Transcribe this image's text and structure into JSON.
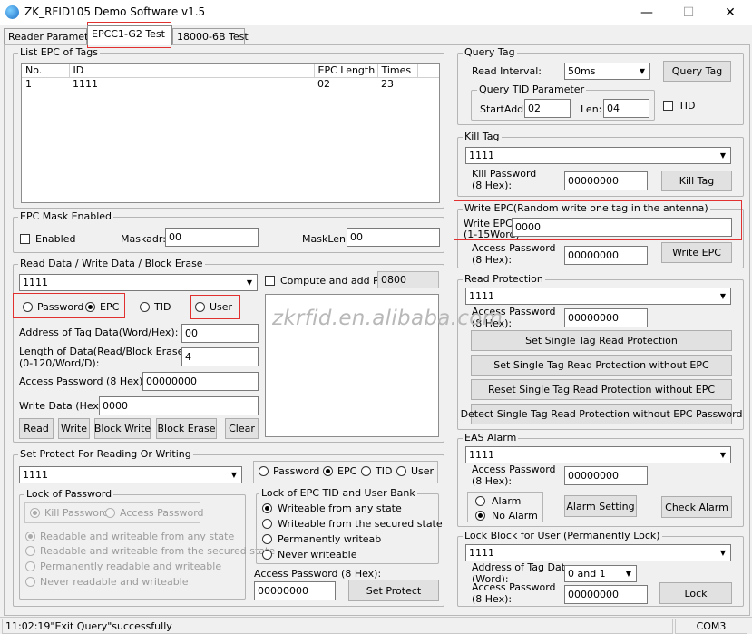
{
  "window": {
    "title": "ZK_RFID105 Demo Software v1.5",
    "minimize": "—",
    "maximize": "☐",
    "close": "✕"
  },
  "tabs": [
    "Reader Parameter",
    "EPCC1-G2 Test",
    "18000-6B Test"
  ],
  "list_epc": {
    "legend": "List EPC of Tags",
    "columns": [
      "No.",
      "ID",
      "EPC Length",
      "Times"
    ],
    "rows": [
      [
        "1",
        "1111",
        "02",
        "23"
      ]
    ]
  },
  "epc_mask": {
    "legend": "EPC Mask Enabled",
    "enabled_label": "Enabled",
    "maskadr_label": "Maskadr:",
    "maskadr_value": "00",
    "masklen_label": "MaskLen:",
    "masklen_value": "00"
  },
  "rw": {
    "legend": "Read Data / Write Data / Block Erase",
    "tag_select": "1111",
    "compute_pc_label": "Compute and add PC:",
    "pc_value": "0800",
    "radio_password": "Password",
    "radio_epc": "EPC",
    "radio_tid": "TID",
    "radio_user": "User",
    "addr_label": "Address of Tag Data(Word/Hex):",
    "addr_value": "00",
    "length_label_1": "Length of Data(Read/Block Erase)",
    "length_label_2": "(0-120/Word/D):",
    "length_value": "4",
    "access_pwd_label": "Access Password (8 Hex):",
    "access_pwd_value": "00000000",
    "write_data_label": "Write Data (Hex):",
    "write_data_value": "0000",
    "btn_read": "Read",
    "btn_write": "Write",
    "btn_block_write": "Block Write",
    "btn_block_erase": "Block Erase",
    "btn_clear": "Clear"
  },
  "protect": {
    "legend": "Set Protect For Reading Or Writing",
    "tag_select": "1111",
    "radio_password": "Password",
    "radio_epc": "EPC",
    "radio_tid": "TID",
    "radio_user": "User",
    "lock_pwd_legend": "Lock of Password",
    "kill_password": "Kill Password",
    "access_password": "Access Password",
    "opt1": "Readable and  writeable from any state",
    "opt2": "Readable and writeable from the secured state",
    "opt3": "Permanently readable and writeable",
    "opt4": "Never readable and writeable",
    "lock_epc_legend": "Lock of EPC TID and User Bank",
    "e1": "Writeable from any state",
    "e2": "Writeable from the secured state",
    "e3": "Permanently writeab",
    "e4": "Never writeable",
    "access_label": "Access Password (8 Hex):",
    "access_value": "00000000",
    "btn_set_protect": "Set Protect"
  },
  "query": {
    "legend": "Query Tag",
    "interval_label": "Read Interval:",
    "interval_value": "50ms",
    "btn_query": "Query Tag",
    "tid_legend": "Query TID Parameter",
    "start_label": "StartAddr:",
    "start_value": "02",
    "len_label": "Len:",
    "len_value": "04",
    "tid_check": "TID"
  },
  "kill": {
    "legend": "Kill Tag",
    "tag_select": "1111",
    "pwd_label_1": "Kill Password",
    "pwd_label_2": "(8 Hex):",
    "pwd_value": "00000000",
    "btn_kill": "Kill Tag"
  },
  "write_epc": {
    "legend": "Write EPC(Random write one tag in the antenna)",
    "epc_label_1": "Write EPC:",
    "epc_label_2": "(1-15Word)",
    "epc_value": "0000",
    "pwd_label_1": "Access Password",
    "pwd_label_2": "(8 Hex):",
    "pwd_value": "00000000",
    "btn_write": "Write EPC"
  },
  "read_protect": {
    "legend": "Read Protection",
    "tag_select": "1111",
    "pwd_label_1": "Access Password",
    "pwd_label_2": "(8 Hex):",
    "pwd_value": "00000000",
    "btn1": "Set Single Tag Read Protection",
    "btn2": "Set Single Tag Read Protection without EPC",
    "btn3": "Reset Single Tag Read Protection without EPC",
    "btn4": "Detect Single Tag Read Protection without EPC Password"
  },
  "eas": {
    "legend": "EAS Alarm",
    "tag_select": "1111",
    "pwd_label_1": "Access Password",
    "pwd_label_2": "(8 Hex):",
    "pwd_value": "00000000",
    "radio_alarm": "Alarm",
    "radio_no_alarm": "No Alarm",
    "btn_setting": "Alarm Setting",
    "btn_check": "Check Alarm"
  },
  "lock_block": {
    "legend": "Lock Block for User (Permanently Lock)",
    "tag_select": "1111",
    "addr_label_1": "Address of Tag Data",
    "addr_label_2": "(Word):",
    "addr_value": "0 and 1",
    "pwd_label_1": "Access Password",
    "pwd_label_2": "(8 Hex):",
    "pwd_value": "00000000",
    "btn_lock": "Lock"
  },
  "watermark": "zkrfid.en.alibaba.com",
  "status": {
    "message": "11:02:19\"Exit Query\"successfully",
    "port": "COM3"
  },
  "colors": {
    "highlight": "#e0302f"
  }
}
